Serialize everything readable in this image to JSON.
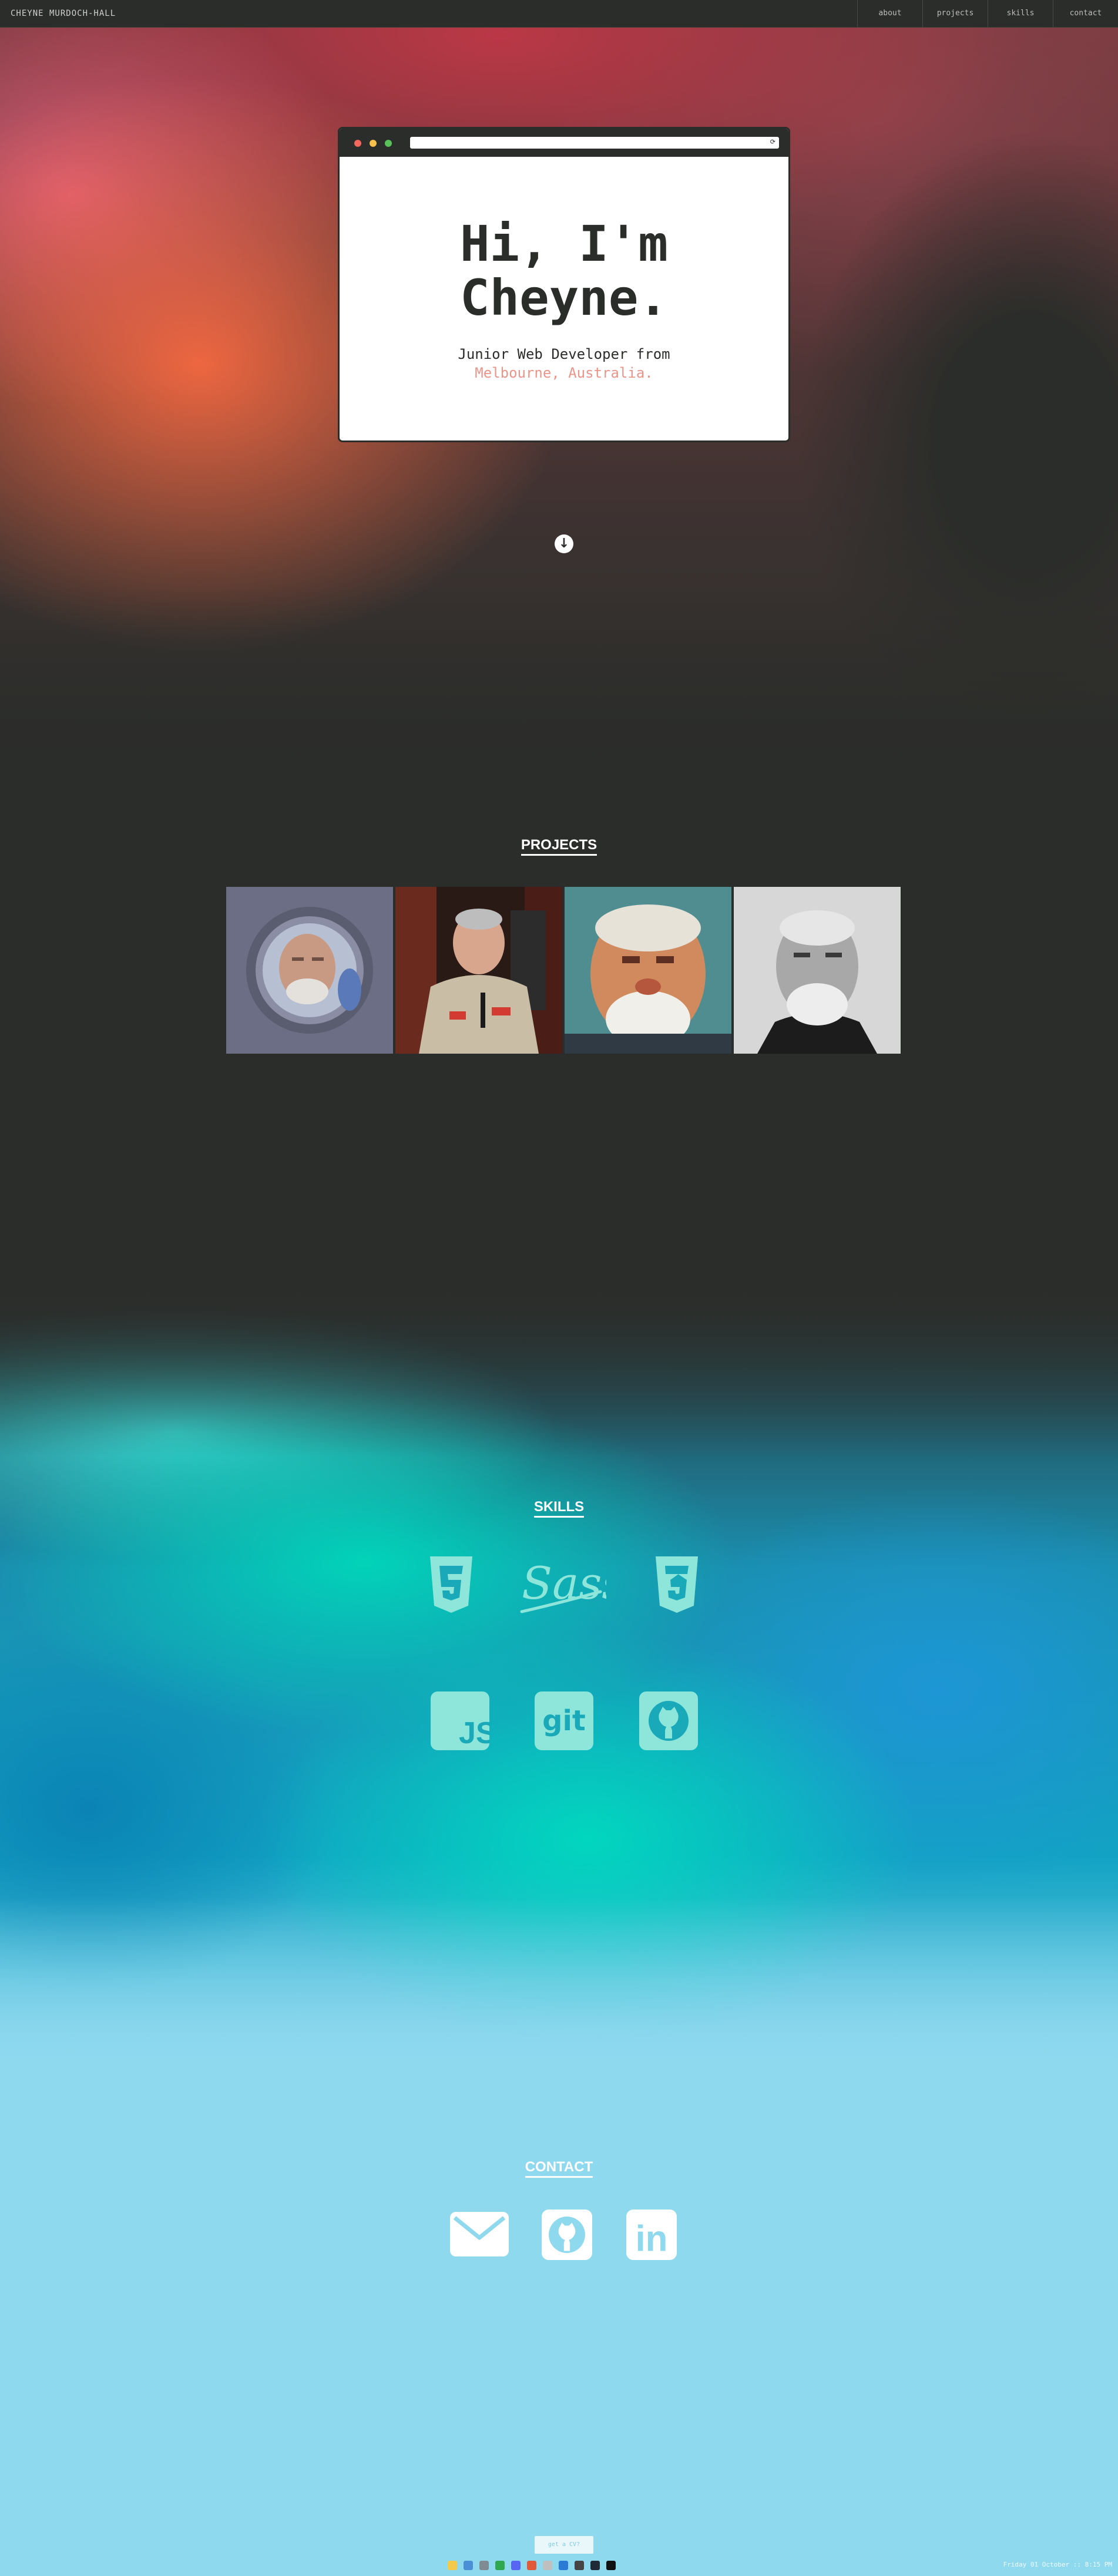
{
  "nav": {
    "brand": "CHEYNE MURDOCH-HALL",
    "links": [
      "about",
      "projects",
      "skills",
      "contact"
    ]
  },
  "hero": {
    "title_line1": "Hi, I'm",
    "title_line2": "Cheyne.",
    "subtitle": "Junior Web Developer from",
    "location": "Melbourne, Australia.",
    "url_bar_icon": "refresh-icon",
    "scroll_icon": "arrow-down-circle-icon"
  },
  "projects": {
    "heading": "PROJECTS",
    "tiles": [
      "project-tile-1",
      "project-tile-2",
      "project-tile-3",
      "project-tile-4"
    ]
  },
  "skills": {
    "heading": "SKILLS",
    "icons": [
      "html5-icon",
      "sass-icon",
      "css3-icon",
      "javascript-icon",
      "git-icon",
      "github-icon"
    ],
    "sass_wordmark": "Sass",
    "js_label": "JS",
    "git_label": "git"
  },
  "contact": {
    "heading": "CONTACT",
    "icons": [
      "email-icon",
      "github-icon",
      "linkedin-icon"
    ],
    "linkedin_label": "in"
  },
  "footer": {
    "cta_label": "get a CV?"
  },
  "taskbar": {
    "clock": "Friday 01 October  ::  8:15 PM"
  },
  "colors": {
    "dark": "#2b2d2a",
    "accent_location": "#e9958a",
    "contact_bg": "#8fd9ef",
    "skill_icon": "#7fe3d4"
  }
}
